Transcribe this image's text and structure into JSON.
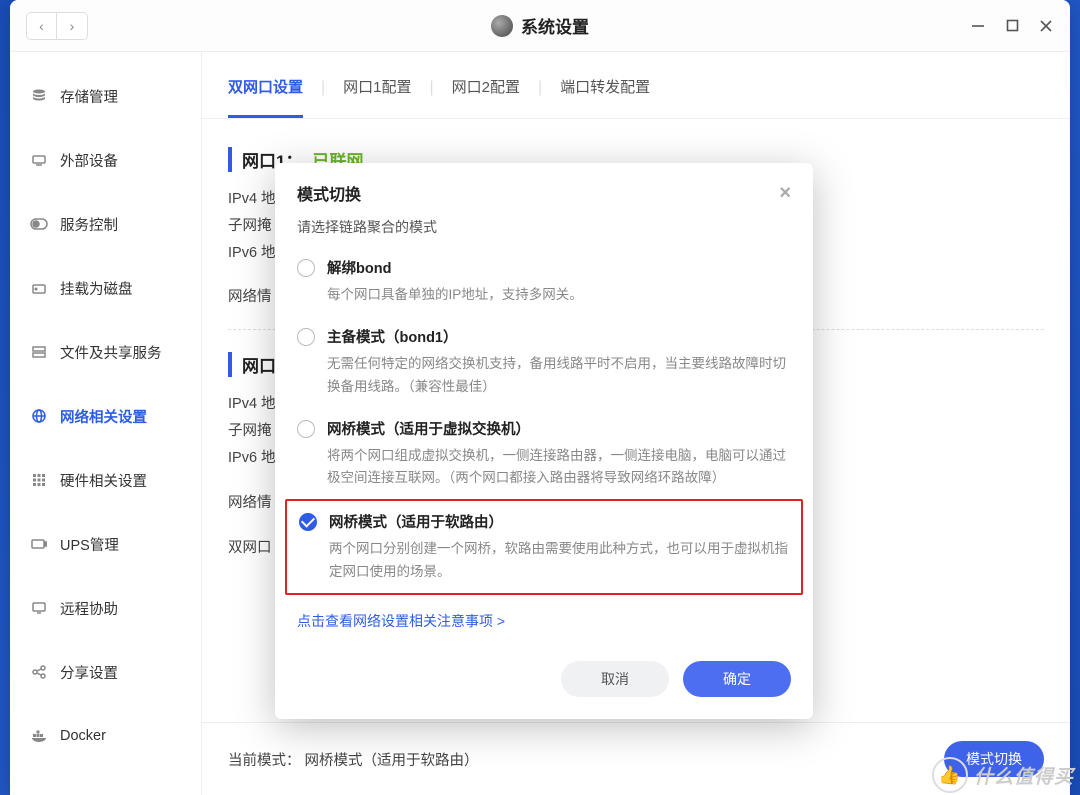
{
  "window": {
    "title": "系统设置"
  },
  "sidebar": {
    "items": [
      {
        "label": "存储管理"
      },
      {
        "label": "外部设备"
      },
      {
        "label": "服务控制"
      },
      {
        "label": "挂载为磁盘"
      },
      {
        "label": "文件及共享服务"
      },
      {
        "label": "网络相关设置"
      },
      {
        "label": "硬件相关设置"
      },
      {
        "label": "UPS管理"
      },
      {
        "label": "远程协助"
      },
      {
        "label": "分享设置"
      },
      {
        "label": "Docker"
      }
    ]
  },
  "tabs": [
    {
      "label": "双网口设置",
      "active": true
    },
    {
      "label": "网口1配置"
    },
    {
      "label": "网口2配置"
    },
    {
      "label": "端口转发配置"
    }
  ],
  "port1": {
    "header_prefix": "网口1：",
    "status": "已联网",
    "ipv4_label": "IPv4 地",
    "subnet_label": "子网掩",
    "ipv6_label": "IPv6 地",
    "info_label": "网络情"
  },
  "port2": {
    "header": "网口2",
    "ipv4_label": "IPv4 地",
    "subnet_label": "子网掩",
    "ipv6_label": "IPv6 地",
    "info_label": "网络情",
    "dual_label": "双网口"
  },
  "footer": {
    "current_label": "当前模式：",
    "current_value": "网桥模式（适用于软路由）",
    "switch_btn": "模式切换"
  },
  "modal": {
    "title": "模式切换",
    "subtitle": "请选择链路聚合的模式",
    "options": [
      {
        "title": "解绑bond",
        "desc": "每个网口具备单独的IP地址，支持多网关。",
        "checked": false
      },
      {
        "title": "主备模式（bond1）",
        "desc": "无需任何特定的网络交换机支持，备用线路平时不启用，当主要线路故障时切换备用线路。（兼容性最佳）",
        "checked": false
      },
      {
        "title": "网桥模式（适用于虚拟交换机）",
        "desc": "将两个网口组成虚拟交换机，一侧连接路由器，一侧连接电脑，电脑可以通过极空间连接互联网。（两个网口都接入路由器将导致网络环路故障）",
        "checked": false
      },
      {
        "title": "网桥模式（适用于软路由）",
        "desc": "两个网口分别创建一个网桥，软路由需要使用此种方式，也可以用于虚拟机指定网口使用的场景。",
        "checked": true
      }
    ],
    "link": "点击查看网络设置相关注意事项 >",
    "cancel": "取消",
    "ok": "确定"
  },
  "watermark": {
    "text": "什么值得买"
  }
}
